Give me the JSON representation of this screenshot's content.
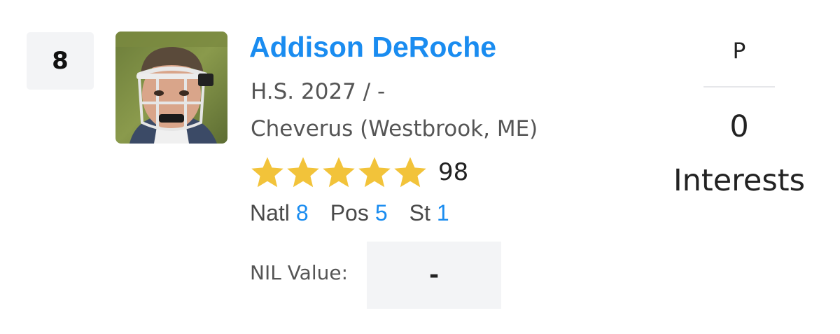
{
  "player": {
    "rank": "8",
    "name": "Addison DeRoche",
    "class_line": "H.S. 2027 / -",
    "school_line": "Cheverus (Westbrook, ME)",
    "star_rating": 5,
    "rating_score": "98",
    "star_color": "#f2c33a"
  },
  "rankings": {
    "natl_label": "Natl",
    "natl_value": "8",
    "pos_label": "Pos",
    "pos_value": "5",
    "st_label": "St",
    "st_value": "1"
  },
  "nil": {
    "label": "NIL Value:",
    "value": "-"
  },
  "side": {
    "position": "P",
    "interest_count": "0",
    "interest_label": "Interests"
  },
  "colors": {
    "link_blue": "#1a8cf0",
    "box_gray": "#f3f4f6"
  }
}
